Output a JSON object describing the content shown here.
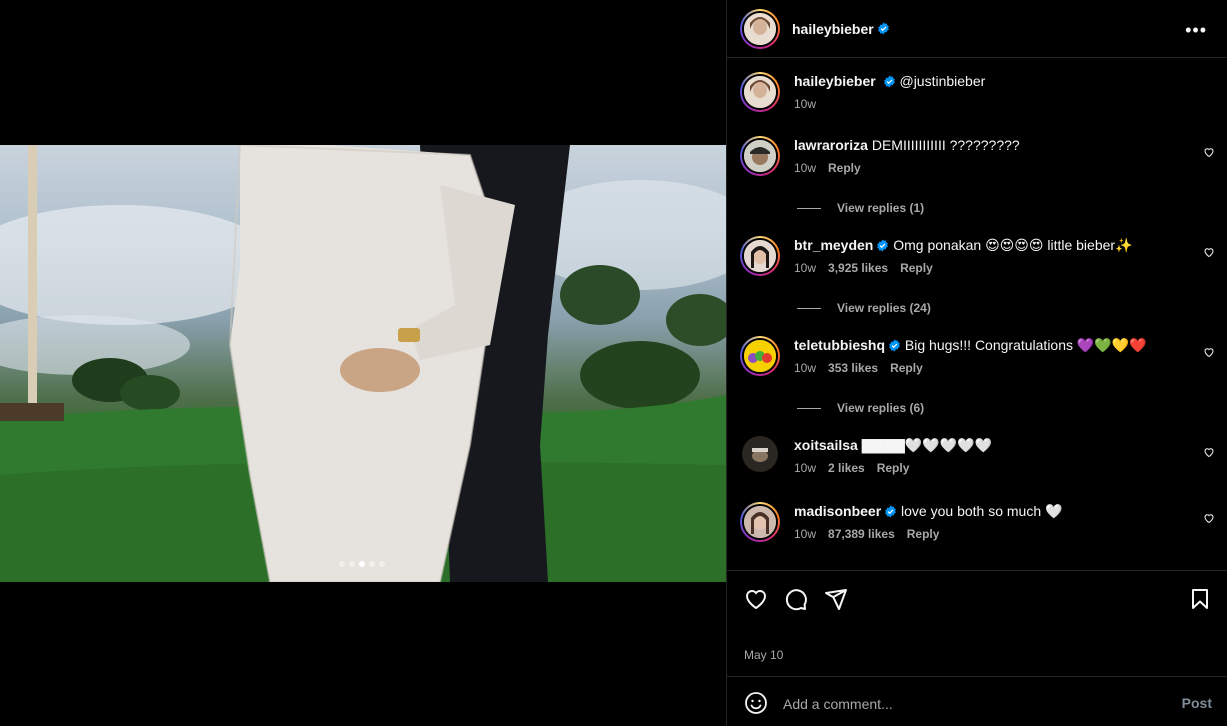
{
  "post": {
    "author": "haileybieber",
    "more_label": "•••",
    "caption_mention": "@justinbieber",
    "caption_time": "10w",
    "date": "May 10",
    "carousel": {
      "total": 5,
      "active_index": 2
    }
  },
  "comments": [
    {
      "user": "lawraroriza",
      "verified": false,
      "text": "DEMIIIIIIIIIII ?????????",
      "time": "10w",
      "likes": "",
      "reply": "Reply",
      "view_replies": "View replies (1)"
    },
    {
      "user": "btr_meyden",
      "verified": true,
      "text": "Omg ponakan 😍😍😍😍 little bieber✨",
      "time": "10w",
      "likes": "3,925 likes",
      "reply": "Reply",
      "view_replies": "View replies (24)"
    },
    {
      "user": "teletubbieshq",
      "verified": true,
      "text": "Big hugs!!! Congratulations 💜💚💛❤️",
      "time": "10w",
      "likes": "353 likes",
      "reply": "Reply",
      "view_replies": "View replies (6)"
    },
    {
      "user": "xoitsailsa",
      "verified": false,
      "text": "▇▇▇▇🤍🤍🤍🤍🤍",
      "time": "10w",
      "likes": "2 likes",
      "reply": "Reply",
      "view_replies": ""
    },
    {
      "user": "madisonbeer",
      "verified": true,
      "text": "love you both so much 🤍",
      "time": "10w",
      "likes": "87,389 likes",
      "reply": "Reply",
      "view_replies": ""
    }
  ],
  "composer": {
    "placeholder": "Add a comment...",
    "post_label": "Post"
  },
  "colors": {
    "background": "#000000",
    "verified": "#0095f6",
    "muted": "#a8a8a8"
  }
}
